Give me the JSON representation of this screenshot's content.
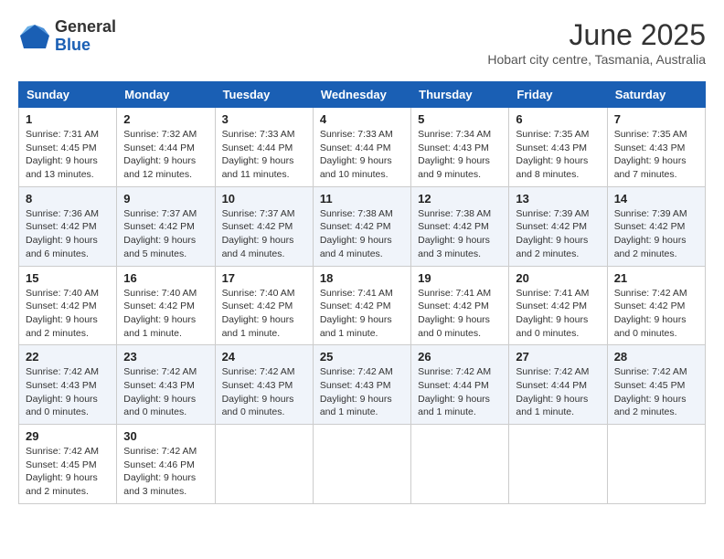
{
  "logo": {
    "general": "General",
    "blue": "Blue"
  },
  "header": {
    "month": "June 2025",
    "location": "Hobart city centre, Tasmania, Australia"
  },
  "days_of_week": [
    "Sunday",
    "Monday",
    "Tuesday",
    "Wednesday",
    "Thursday",
    "Friday",
    "Saturday"
  ],
  "weeks": [
    [
      {
        "day": "1",
        "sunrise": "7:31 AM",
        "sunset": "4:45 PM",
        "daylight": "9 hours and 13 minutes."
      },
      {
        "day": "2",
        "sunrise": "7:32 AM",
        "sunset": "4:44 PM",
        "daylight": "9 hours and 12 minutes."
      },
      {
        "day": "3",
        "sunrise": "7:33 AM",
        "sunset": "4:44 PM",
        "daylight": "9 hours and 11 minutes."
      },
      {
        "day": "4",
        "sunrise": "7:33 AM",
        "sunset": "4:44 PM",
        "daylight": "9 hours and 10 minutes."
      },
      {
        "day": "5",
        "sunrise": "7:34 AM",
        "sunset": "4:43 PM",
        "daylight": "9 hours and 9 minutes."
      },
      {
        "day": "6",
        "sunrise": "7:35 AM",
        "sunset": "4:43 PM",
        "daylight": "9 hours and 8 minutes."
      },
      {
        "day": "7",
        "sunrise": "7:35 AM",
        "sunset": "4:43 PM",
        "daylight": "9 hours and 7 minutes."
      }
    ],
    [
      {
        "day": "8",
        "sunrise": "7:36 AM",
        "sunset": "4:42 PM",
        "daylight": "9 hours and 6 minutes."
      },
      {
        "day": "9",
        "sunrise": "7:37 AM",
        "sunset": "4:42 PM",
        "daylight": "9 hours and 5 minutes."
      },
      {
        "day": "10",
        "sunrise": "7:37 AM",
        "sunset": "4:42 PM",
        "daylight": "9 hours and 4 minutes."
      },
      {
        "day": "11",
        "sunrise": "7:38 AM",
        "sunset": "4:42 PM",
        "daylight": "9 hours and 4 minutes."
      },
      {
        "day": "12",
        "sunrise": "7:38 AM",
        "sunset": "4:42 PM",
        "daylight": "9 hours and 3 minutes."
      },
      {
        "day": "13",
        "sunrise": "7:39 AM",
        "sunset": "4:42 PM",
        "daylight": "9 hours and 2 minutes."
      },
      {
        "day": "14",
        "sunrise": "7:39 AM",
        "sunset": "4:42 PM",
        "daylight": "9 hours and 2 minutes."
      }
    ],
    [
      {
        "day": "15",
        "sunrise": "7:40 AM",
        "sunset": "4:42 PM",
        "daylight": "9 hours and 2 minutes."
      },
      {
        "day": "16",
        "sunrise": "7:40 AM",
        "sunset": "4:42 PM",
        "daylight": "9 hours and 1 minute."
      },
      {
        "day": "17",
        "sunrise": "7:40 AM",
        "sunset": "4:42 PM",
        "daylight": "9 hours and 1 minute."
      },
      {
        "day": "18",
        "sunrise": "7:41 AM",
        "sunset": "4:42 PM",
        "daylight": "9 hours and 1 minute."
      },
      {
        "day": "19",
        "sunrise": "7:41 AM",
        "sunset": "4:42 PM",
        "daylight": "9 hours and 0 minutes."
      },
      {
        "day": "20",
        "sunrise": "7:41 AM",
        "sunset": "4:42 PM",
        "daylight": "9 hours and 0 minutes."
      },
      {
        "day": "21",
        "sunrise": "7:42 AM",
        "sunset": "4:42 PM",
        "daylight": "9 hours and 0 minutes."
      }
    ],
    [
      {
        "day": "22",
        "sunrise": "7:42 AM",
        "sunset": "4:43 PM",
        "daylight": "9 hours and 0 minutes."
      },
      {
        "day": "23",
        "sunrise": "7:42 AM",
        "sunset": "4:43 PM",
        "daylight": "9 hours and 0 minutes."
      },
      {
        "day": "24",
        "sunrise": "7:42 AM",
        "sunset": "4:43 PM",
        "daylight": "9 hours and 0 minutes."
      },
      {
        "day": "25",
        "sunrise": "7:42 AM",
        "sunset": "4:43 PM",
        "daylight": "9 hours and 1 minute."
      },
      {
        "day": "26",
        "sunrise": "7:42 AM",
        "sunset": "4:44 PM",
        "daylight": "9 hours and 1 minute."
      },
      {
        "day": "27",
        "sunrise": "7:42 AM",
        "sunset": "4:44 PM",
        "daylight": "9 hours and 1 minute."
      },
      {
        "day": "28",
        "sunrise": "7:42 AM",
        "sunset": "4:45 PM",
        "daylight": "9 hours and 2 minutes."
      }
    ],
    [
      {
        "day": "29",
        "sunrise": "7:42 AM",
        "sunset": "4:45 PM",
        "daylight": "9 hours and 2 minutes."
      },
      {
        "day": "30",
        "sunrise": "7:42 AM",
        "sunset": "4:46 PM",
        "daylight": "9 hours and 3 minutes."
      },
      null,
      null,
      null,
      null,
      null
    ]
  ]
}
